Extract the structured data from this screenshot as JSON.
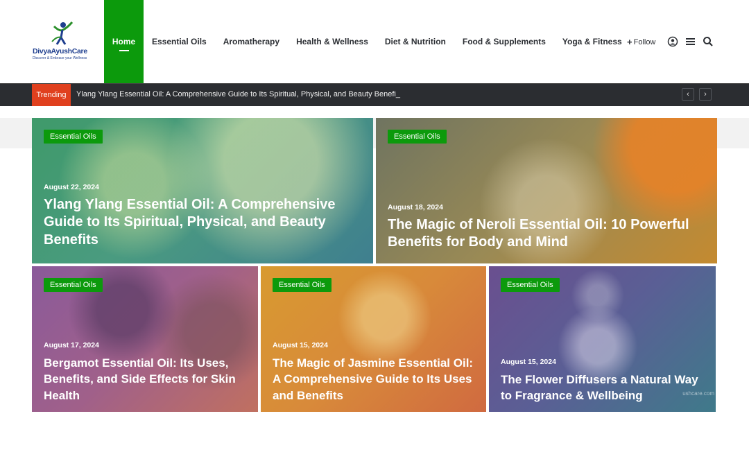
{
  "brand": {
    "name": "DivyaAyushCare",
    "tagline": "Discover & Embrace your Wellness"
  },
  "nav": {
    "items": [
      {
        "label": "Home",
        "active": true
      },
      {
        "label": "Essential Oils"
      },
      {
        "label": "Aromatherapy"
      },
      {
        "label": "Health & Wellness"
      },
      {
        "label": "Diet & Nutrition"
      },
      {
        "label": "Food & Supplements"
      },
      {
        "label": "Yoga & Fitness"
      }
    ],
    "follow": "Follow",
    "icons": [
      "user-icon",
      "menu-icon",
      "search-icon"
    ]
  },
  "trending": {
    "label": "Trending",
    "text": "Ylang Ylang Essential Oil: A Comprehensive Guide to Its Spiritual, Physical, and Beauty Benefi_",
    "prev_icon": "‹",
    "next_icon": "›"
  },
  "colors": {
    "accent": "#0c9a0c",
    "trending": "#e0401e",
    "bar": "#2b2d31"
  },
  "posts": [
    {
      "category": "Essential Oils",
      "date": "August 22, 2024",
      "title": "Ylang Ylang Essential Oil: A Comprehensive Guide to Its Spiritual, Physical, and Beauty Benefits"
    },
    {
      "category": "Essential Oils",
      "date": "August 18, 2024",
      "title": "The Magic of Neroli Essential Oil: 10 Powerful Benefits for Body and Mind"
    },
    {
      "category": "Essential Oils",
      "date": "August 17, 2024",
      "title": "Bergamot Essential Oil: Its Uses, Benefits, and Side Effects for Skin Health"
    },
    {
      "category": "Essential Oils",
      "date": "August 15, 2024",
      "title": "The Magic of Jasmine Essential Oil: A Comprehensive Guide to Its Uses and Benefits"
    },
    {
      "category": "Essential Oils",
      "date": "August 15, 2024",
      "title": "The Flower Diffusers a Natural Way to Fragrance & Wellbeing",
      "watermark": "ushcare.com"
    }
  ]
}
